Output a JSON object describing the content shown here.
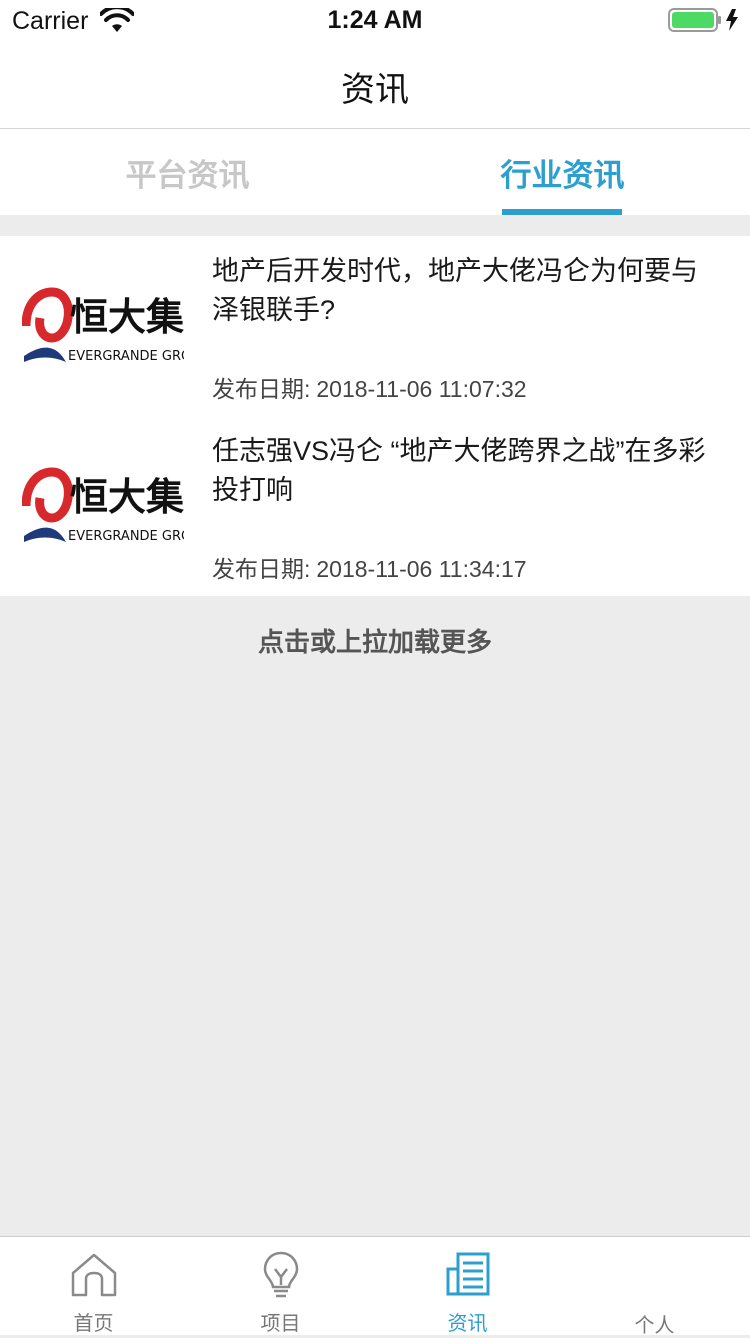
{
  "status_bar": {
    "carrier": "Carrier",
    "time": "1:24 AM",
    "wifi_icon": "wifi-icon",
    "battery_icon": "battery-charging-icon",
    "battery_color": "#4cd964"
  },
  "nav": {
    "title": "资讯"
  },
  "tabs": [
    {
      "label": "平台资讯",
      "active": false
    },
    {
      "label": "行业资讯",
      "active": true
    }
  ],
  "accent_color": "#2d9fcf",
  "news": [
    {
      "title": "地产后开发时代，地产大佬冯仑为何要与泽银联手?",
      "date_label": "发布日期:",
      "date": "2018-11-06 11:07:32",
      "logo": {
        "name_cn": "恒大集团",
        "name_en": "EVERGRANDE GROUP"
      }
    },
    {
      "title": "任志强VS冯仑 “地产大佬跨界之战”在多彩投打响",
      "date_label": "发布日期:",
      "date": "2018-11-06 11:34:17",
      "logo": {
        "name_cn": "恒大集团",
        "name_en": "EVERGRANDE GROUP"
      }
    }
  ],
  "load_more": "点击或上拉加载更多",
  "tabbar": [
    {
      "label": "首页",
      "icon": "home-icon",
      "active": false
    },
    {
      "label": "项目",
      "icon": "lightbulb-icon",
      "active": false
    },
    {
      "label": "资讯",
      "icon": "newspaper-icon",
      "active": true
    },
    {
      "label": "个人",
      "icon": "person-icon",
      "active": false
    }
  ]
}
